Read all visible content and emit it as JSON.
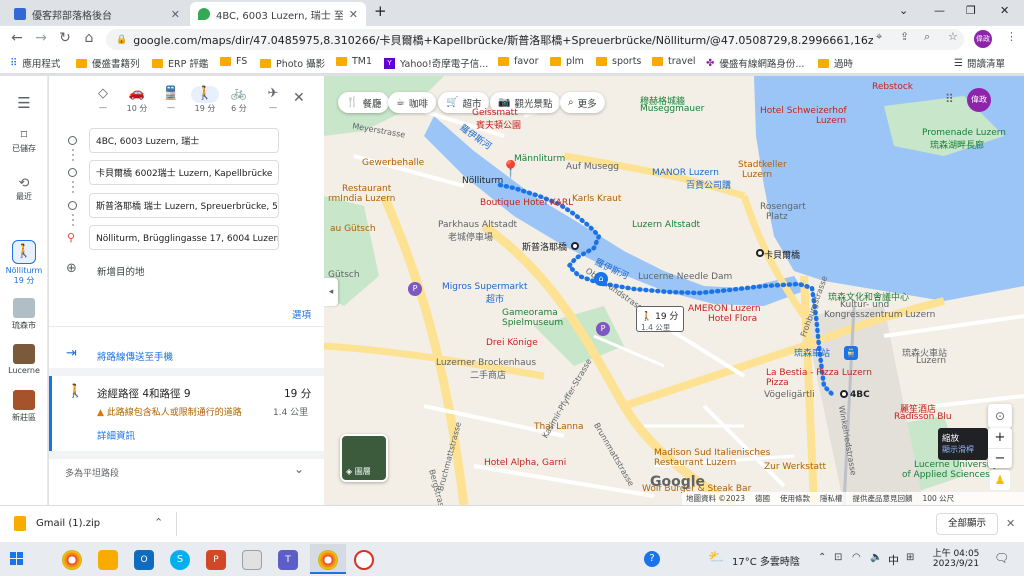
{
  "browser": {
    "tabs": [
      {
        "title": "優客邦部落格後台",
        "active": false
      },
      {
        "title": "4BC, 6003 Luzern, 瑞士 至 Nölliturm",
        "active": true
      }
    ],
    "new_tab": "+",
    "url": "google.com/maps/dir/47.0485975,8.310266/卡貝爾橋+Kapellbrücke/斯普洛耶橋+Spreuerbrücke/Nölliturm/@47.0508729,8.2996661,16z/data=!3m...",
    "profile": "偉政",
    "bookmarks": [
      "應用程式",
      "優盛書籍列",
      "ERP 評鑑",
      "FS",
      "Photo 攝影",
      "TM1",
      "Yahoo!奇摩電子信...",
      "favor",
      "plm",
      "sports",
      "travel",
      "優盛有線網路身份...",
      "過時"
    ],
    "reading_list": "閱讀清單"
  },
  "rail": {
    "items": [
      {
        "label": "已儲存"
      },
      {
        "label": "最近"
      },
      {
        "label": "Nölliturm",
        "sub": "19 分"
      },
      {
        "label": "琉森市"
      },
      {
        "label": "Lucerne"
      },
      {
        "label": "新莊區"
      }
    ]
  },
  "panel": {
    "modes": [
      {
        "name": "best",
        "time": "—"
      },
      {
        "name": "car",
        "time": "10 分"
      },
      {
        "name": "transit",
        "time": "—"
      },
      {
        "name": "walk",
        "time": "19 分"
      },
      {
        "name": "bike",
        "time": "6 分"
      },
      {
        "name": "flight",
        "time": "—"
      }
    ],
    "stops": [
      "4BC, 6003 Luzern, 瑞士",
      "卡貝爾橋 6002瑞士 Luzern, Kapellbrücke",
      "斯普洛耶橋 瑞士 Luzern, Spreuerbrücke, 5",
      "Nölliturm, Brügglingasse 17, 6004 Luzern, 瑞士"
    ],
    "add_destination": "新增目的地",
    "options": "選項",
    "send_to_phone": "將路線傳送至手機",
    "route": {
      "via": "途經路徑 4和路徑 9",
      "time": "19 分",
      "warning": "此路線包含私人或限制通行的道路",
      "distance": "1.4 公里",
      "details": "詳細資訊"
    },
    "similar": "多為平坦路段"
  },
  "map": {
    "chips": [
      "餐廳",
      "咖啡",
      "超市",
      "觀光景點",
      "更多"
    ],
    "route_box": {
      "time": "19 分",
      "distance": "1.4 公里"
    },
    "layers": "圖層",
    "zoom_tooltip": {
      "title": "縮放",
      "sub": "顯示滑桿"
    },
    "footer": [
      "地圖資料 ©2023",
      "德國",
      "使用條款",
      "隱私權",
      "提供產品意見回饋",
      "100 公尺"
    ],
    "labels": {
      "muhle": "穆赫格城牆",
      "musegg": "Museggmauer",
      "rebstock": "Rebstock",
      "schweizerhof": "Hotel Schweizerhof",
      "schweizerhof2": "Luzern",
      "promenade": "Promenade Luzern",
      "promenade2": "琉森湖畔長廊",
      "gessnerallee": "Geissmatt",
      "gessnerallee2": "賓夫頓公園",
      "mannliturm": "Männliturm",
      "ausenegg": "Auf Musegg",
      "manor": "MANOR Luzern",
      "manor2": "百貨公司購",
      "stadtkeller": "Stadtkeller",
      "stadtkeller2": "Luzern",
      "rosengart": "Rosengart",
      "rosengart2": "Platz",
      "gewerbehalle": "Gewerbehalle",
      "nolliturm": "Nölliturm",
      "karlskraut": "Karls Kraut",
      "boutique": "Boutique Hotel KARL",
      "altstadt": "Luzern Altstadt",
      "restaurant": "Restaurant",
      "restaurant2": "rmIndia Luzern",
      "parkhaus": "Parkhaus Altstadt",
      "parkhaus2": "老城停車場",
      "spreuer": "斯普洛耶橋",
      "kapell": "卡貝爾橋",
      "gutsch": "au Gütsch",
      "gutsch2": "Gütsch",
      "reuss": "羅伊斯河",
      "reuss2": "羅伊斯河",
      "needle": "Lucerne Needle Dam",
      "migros": "Migros Supermarkt",
      "migros2": "超市",
      "gameorama": "Gameorama",
      "gameorama2": "Spielmuseum",
      "kkl": "琉森文化和會議中心",
      "kkl2": "Kultur- und",
      "kkl3": "Kongresszentrum Luzern",
      "flora": "AMERON Luzern",
      "flora2": "Hotel Flora",
      "dreikonige": "Drei Könige",
      "station": "琉森車站",
      "station2": "琉森火車站",
      "station3": "Luzern",
      "brockenhaus": "Luzerner Brockenhaus",
      "brockenhaus2": "二手商店",
      "labestia": "La Bestia - Pizza Luzern",
      "labestia2": "Pizza",
      "vogeligartli": "Vögeligärtli",
      "bc4": "4BC",
      "radisson": "麗笙酒店",
      "radisson2": "Radisson Blu",
      "thailanna": "Thai Lanna",
      "sud": "Madison Sud Italienisches",
      "sud2": "Restaurant Luzern",
      "alpha": "Hotel Alpha, Garni",
      "zurwerkstatt": "Zur Werkstatt",
      "wolfburger": "Wolf Burger & Steak Bar",
      "hsl": "Lucerne University",
      "hsl2": "of Applied Sciences",
      "pfyffer": "Kasimir-Pfyffer-Strasse",
      "bruch": "Bruchmattstrasse",
      "brun": "Brunnmattstrasse",
      "bergstr": "Bergstrasse",
      "winkel": "Winkelriedstrasse",
      "frohburg": "Frohburgstrasse",
      "obergr": "Obergrundstrasse",
      "meyerstrasse": "Meyerstrasse",
      "google": "Google"
    }
  },
  "downloads": {
    "file": "Gmail (1).zip",
    "show_all": "全部顯示"
  },
  "taskbar": {
    "weather": "17°C 多雲時陰",
    "ime": "中",
    "time": "上午 04:05",
    "date": "2023/9/21"
  },
  "colors": {
    "route": "#1a73e8",
    "water": "#9cc5f7",
    "park": "#c8e6c9",
    "road": "#fde293"
  }
}
